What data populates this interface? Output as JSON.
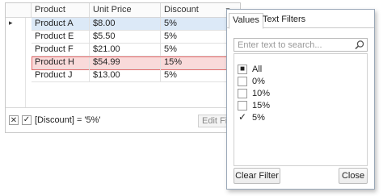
{
  "grid": {
    "columns": [
      "Product",
      "Unit Price",
      "Discount"
    ],
    "rows": [
      {
        "product": "Product A",
        "price": "$8.00",
        "discount": "5%"
      },
      {
        "product": "Product E",
        "price": "$5.50",
        "discount": "5%"
      },
      {
        "product": "Product F",
        "price": "$21.00",
        "discount": "5%"
      },
      {
        "product": "Product H",
        "price": "$54.99",
        "discount": "15%"
      },
      {
        "product": "Product J",
        "price": "$13.00",
        "discount": "5%"
      }
    ],
    "current_row_glyph": "▸",
    "filter_dropdown_glyph": "▼"
  },
  "filter_bar": {
    "clear_glyph": "✕",
    "check_glyph": "✓",
    "expression": "[Discount] = '5%'",
    "edit_filter_label": "Edit Filter"
  },
  "popup": {
    "tabs": [
      "Values",
      "Text Filters"
    ],
    "search_placeholder": "Enter text to search...",
    "items": [
      {
        "label": "All",
        "state": "■"
      },
      {
        "label": "0%",
        "state": ""
      },
      {
        "label": "10%",
        "state": ""
      },
      {
        "label": "15%",
        "state": ""
      },
      {
        "label": "5%",
        "state": "✓"
      }
    ],
    "clear_filter_label": "Clear Filter",
    "close_label": "Close"
  },
  "colors": {
    "selected_row": "#dce9f7",
    "highlight_row": "#f9dada",
    "highlight_border": "#e86a6a"
  }
}
